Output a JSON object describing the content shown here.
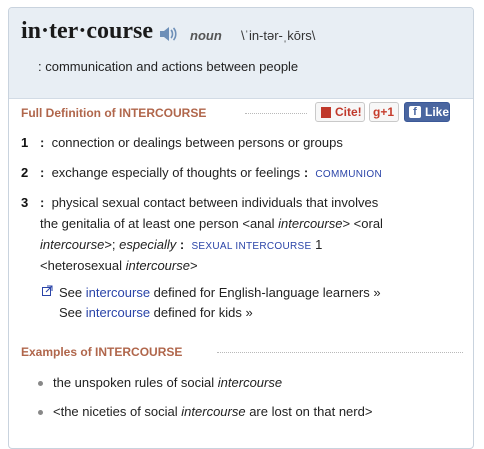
{
  "entry": {
    "headword": "in·ter·course",
    "pos": "noun",
    "pronunciation": "\\ˈin-tər-ˌkōrs\\",
    "gloss": ": communication and actions between people"
  },
  "full_definition": {
    "title": "Full Definition of INTERCOURSE",
    "cite_label": "Cite!",
    "gplus_label": "g+1",
    "facebook_label": "Like",
    "senses": [
      {
        "num": "1",
        "text": "connection or dealings between persons or groups"
      },
      {
        "num": "2",
        "text": "exchange especially of thoughts or feelings",
        "xref": "COMMUNION"
      },
      {
        "num": "3",
        "line1": "physical sexual contact between individuals that involves",
        "line2_a": "the genitalia of at least one person <anal ",
        "line2_b": "intercourse",
        "line2_c": "> <oral",
        "line3_a": "intercourse",
        "line3_b": ">; ",
        "line3_c": "especially",
        "line3_xref": "SEXUAL INTERCOURSE",
        "line3_num": "1",
        "line4_a": "<heterosexual ",
        "line4_b": "intercourse",
        "line4_c": ">"
      }
    ],
    "see_learners_a": "See ",
    "see_learners_link": "intercourse",
    "see_learners_b": " defined for English-language learners »",
    "see_kids_a": "See ",
    "see_kids_link": "intercourse",
    "see_kids_b": " defined for kids »"
  },
  "examples": {
    "title": "Examples of INTERCOURSE",
    "items": [
      {
        "a": "the unspoken rules of social ",
        "b": "intercourse",
        "c": ""
      },
      {
        "a": "<the niceties of social ",
        "b": "intercourse",
        "c": " are lost on that nerd>"
      }
    ]
  }
}
